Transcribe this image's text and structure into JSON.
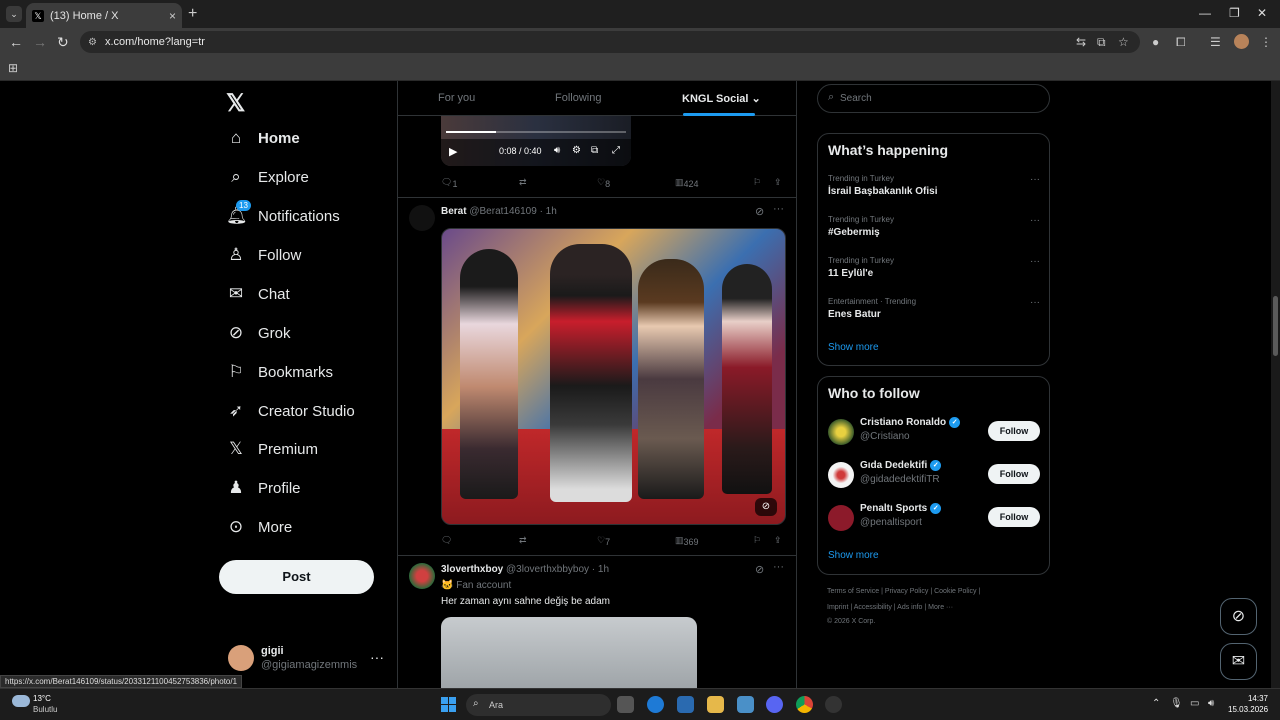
{
  "browser": {
    "tab_title": "(13) Home / X",
    "url": "x.com/home?lang=tr",
    "status_url": "https://x.com/Berat146109/status/2033121100452753836/photo/1"
  },
  "nav": {
    "items": [
      {
        "label": "Home",
        "icon": "home-icon"
      },
      {
        "label": "Explore",
        "icon": "search-icon"
      },
      {
        "label": "Notifications",
        "icon": "bell-icon",
        "badge": "13"
      },
      {
        "label": "Follow",
        "icon": "person-add-icon"
      },
      {
        "label": "Chat",
        "icon": "mail-icon"
      },
      {
        "label": "Grok",
        "icon": "grok-icon"
      },
      {
        "label": "Bookmarks",
        "icon": "bookmark-icon"
      },
      {
        "label": "Creator Studio",
        "icon": "rocket-icon"
      },
      {
        "label": "Premium",
        "icon": "x-icon"
      },
      {
        "label": "Profile",
        "icon": "person-icon"
      },
      {
        "label": "More",
        "icon": "more-circle-icon"
      }
    ],
    "post_label": "Post",
    "user": {
      "name": "gigii",
      "handle": "@gigiamagizemmis"
    }
  },
  "feed": {
    "tabs": [
      "For you",
      "Following",
      "KNGL Social"
    ],
    "video": {
      "time": "0:08 / 0:40"
    },
    "tweet0_stats": {
      "replies": "1",
      "likes": "8",
      "views": "424"
    },
    "tweet1": {
      "name": "Berat",
      "handle": "@Berat146109",
      "time": "· 1h",
      "stats": {
        "replies": "",
        "likes": "7",
        "views": "369"
      }
    },
    "tweet2": {
      "name": "3loverthxboy",
      "handle": "@3loverthxbbyboy",
      "time": "· 1h",
      "sub": "🐱 Fan account",
      "text": "Her zaman aynı sahne değiş be adam"
    }
  },
  "right": {
    "search_placeholder": "Search",
    "whats_happening": "What’s happening",
    "trends": [
      {
        "context": "Trending in Turkey",
        "title": "İsrail Başbakanlık Ofisi"
      },
      {
        "context": "Trending in Turkey",
        "title": "#Gebermiş"
      },
      {
        "context": "Trending in Turkey",
        "title": "11 Eylül'e"
      },
      {
        "context": "Entertainment · Trending",
        "title": "Enes Batur"
      }
    ],
    "show_more": "Show more",
    "who_to_follow": "Who to follow",
    "follow_label": "Follow",
    "suggestions": [
      {
        "name": "Cristiano Ronaldo",
        "handle": "@Cristiano"
      },
      {
        "name": "Gıda Dedektifi",
        "handle": "@gidadedektifiTR"
      },
      {
        "name": "Penaltı Sports",
        "handle": "@penaltisport"
      }
    ],
    "footer_line1": "Terms of Service  |  Privacy Policy  |  Cookie Policy  |",
    "footer_line2": "Imprint  |  Accessibility  |  Ads info  |  More ···",
    "footer_line3": "© 2026 X Corp."
  },
  "taskbar": {
    "temp": "13°C",
    "weather": "Bulutlu",
    "search_placeholder": "Ara",
    "time": "14:37",
    "date": "15.03.2026"
  },
  "colors": {
    "accent": "#1d9bf0",
    "bg": "#000000",
    "border": "#2f3336"
  }
}
